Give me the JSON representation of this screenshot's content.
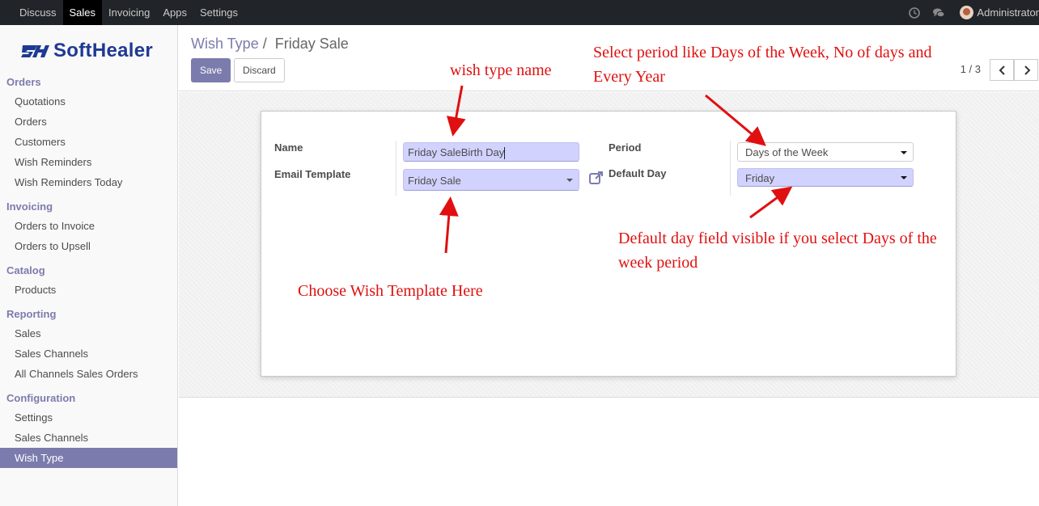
{
  "topbar": {
    "menu": [
      "Discuss",
      "Sales",
      "Invoicing",
      "Apps",
      "Settings"
    ],
    "active": "Sales",
    "user": "Administrator"
  },
  "brand": {
    "logo_text": "SoftHealer"
  },
  "sidebar": {
    "sections": [
      {
        "title": "Orders",
        "items": [
          "Quotations",
          "Orders",
          "Customers",
          "Wish Reminders",
          "Wish Reminders Today"
        ]
      },
      {
        "title": "Invoicing",
        "items": [
          "Orders to Invoice",
          "Orders to Upsell"
        ]
      },
      {
        "title": "Catalog",
        "items": [
          "Products"
        ]
      },
      {
        "title": "Reporting",
        "items": [
          "Sales",
          "Sales Channels",
          "All Channels Sales Orders"
        ]
      },
      {
        "title": "Configuration",
        "items": [
          "Settings",
          "Sales Channels",
          "Wish Type"
        ]
      }
    ],
    "active_item": "Wish Type"
  },
  "breadcrumb": {
    "parent": "Wish Type",
    "separator": "/",
    "current": "Friday Sale"
  },
  "buttons": {
    "save": "Save",
    "discard": "Discard"
  },
  "pager": {
    "value": "1 / 3"
  },
  "form": {
    "name_label": "Name",
    "name_value": "Friday SaleBirth Day",
    "email_template_label": "Email Template",
    "email_template_value": "Friday Sale",
    "period_label": "Period",
    "period_value": "Days of the Week",
    "default_day_label": "Default Day",
    "default_day_value": "Friday"
  },
  "annotations": {
    "wish_type_name": "wish type name",
    "select_period_line1": "Select period like Days of the Week, No of days and",
    "select_period_line2": "Every Year",
    "default_day_line1": "Default day field visible if you select Days of the",
    "default_day_line2": "week period",
    "choose_template": "Choose Wish Template Here"
  },
  "colors": {
    "brand": "#7c7bad",
    "topbar": "#212529",
    "required_field": "#d2d2ff",
    "annotation": "#e01010"
  }
}
